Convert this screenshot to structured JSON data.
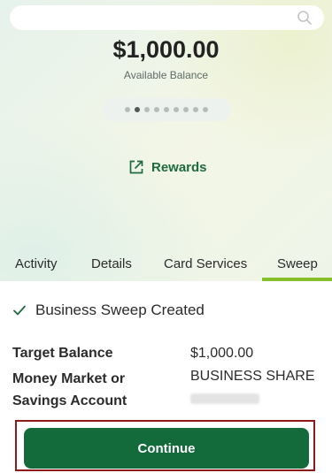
{
  "account": {
    "balance": "$1,000.00",
    "balance_label": "Available Balance",
    "pager": {
      "total": 9,
      "active_index": 1
    }
  },
  "rewards": {
    "label": "Rewards",
    "icon": "external-link-icon"
  },
  "tabs": [
    {
      "label": "Activity"
    },
    {
      "label": "Details"
    },
    {
      "label": "Card Services"
    },
    {
      "label": "Sweep",
      "selected": true
    }
  ],
  "status": {
    "message": "Business Sweep Created",
    "icon": "check-icon"
  },
  "details": {
    "target_balance_label": "Target Balance",
    "target_balance_value": "$1,000.00",
    "account_label": "Money Market or Savings Account",
    "account_value": "BUSINESS SHARE"
  },
  "continue_button": {
    "label": "Continue"
  },
  "colors": {
    "brand_green": "#136a3a",
    "link_green": "#1d6b3f",
    "tab_accent": "#85bf2a",
    "highlight_border": "#8e1b1b"
  }
}
